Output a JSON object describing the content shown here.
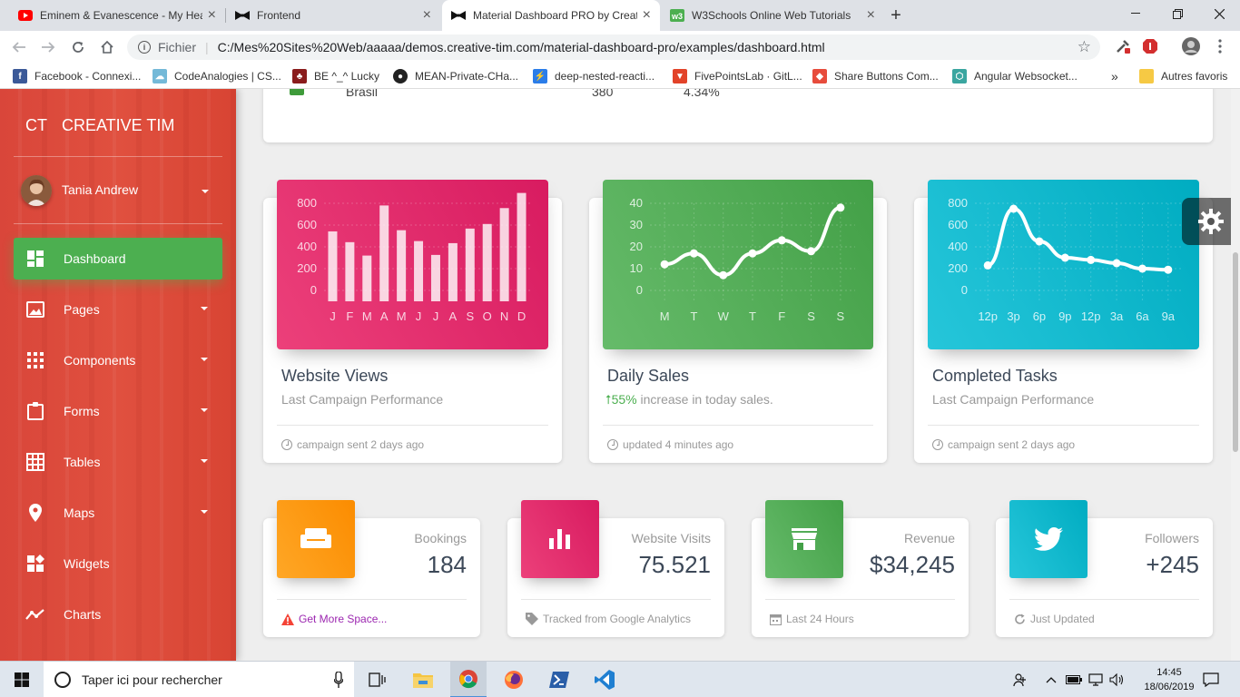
{
  "browser": {
    "tabs": [
      {
        "title": "Eminem & Evanescence - My Heart",
        "icon": "youtube-icon",
        "active": false
      },
      {
        "title": "Frontend",
        "icon": "bow-tie-icon",
        "active": false
      },
      {
        "title": "Material Dashboard PRO by Creative Tim",
        "icon": "bow-tie-icon",
        "active": true
      },
      {
        "title": "W3Schools Online Web Tutorials",
        "icon": "w3schools-icon",
        "active": false
      }
    ],
    "close_glyph": "×",
    "new_tab_glyph": "+",
    "address": {
      "scheme_label": "Fichier",
      "url": "C:/Mes%20Sites%20Web/aaaaa/demos.creative-tim.com/material-dashboard-pro/examples/dashboard.html"
    },
    "bookmarks": [
      {
        "label": "Facebook - Connexi...",
        "color": "#3b5998",
        "glyph": "f"
      },
      {
        "label": "CodeAnalogies | CS...",
        "color": "#74b9d8",
        "glyph": "☁"
      },
      {
        "label": "BE ^_^ Lucky",
        "color": "#8a1c1c",
        "glyph": "♣"
      },
      {
        "label": "MEAN-Private-CHa...",
        "color": "#222222",
        "glyph": "●"
      },
      {
        "label": "deep-nested-reacti...",
        "color": "#2b7de9",
        "glyph": "⚡"
      },
      {
        "label": "FivePointsLab · GitL...",
        "color": "#e24329",
        "glyph": "▼"
      },
      {
        "label": "Share Buttons Com...",
        "color": "#e74c3c",
        "glyph": "◆"
      },
      {
        "label": "Angular Websocket...",
        "color": "#3aa6a0",
        "glyph": "⬡"
      }
    ],
    "bookmarks_more": "»",
    "other_bookmarks": "Autres favoris"
  },
  "sidebar": {
    "logo_mini": "CT",
    "logo_text": "CREATIVE TIM",
    "user_name": "Tania Andrew",
    "items": [
      {
        "label": "Dashboard",
        "icon": "dashboard-icon",
        "active": true,
        "has_caret": false
      },
      {
        "label": "Pages",
        "icon": "image-icon",
        "active": false,
        "has_caret": true
      },
      {
        "label": "Components",
        "icon": "apps-grid-icon",
        "active": false,
        "has_caret": true
      },
      {
        "label": "Forms",
        "icon": "clipboard-icon",
        "active": false,
        "has_caret": true
      },
      {
        "label": "Tables",
        "icon": "grid-table-icon",
        "active": false,
        "has_caret": true
      },
      {
        "label": "Maps",
        "icon": "map-pin-icon",
        "active": false,
        "has_caret": true
      },
      {
        "label": "Widgets",
        "icon": "widgets-icon",
        "active": false,
        "has_caret": false
      },
      {
        "label": "Charts",
        "icon": "timeline-icon",
        "active": false,
        "has_caret": false
      }
    ]
  },
  "top_table_row": {
    "country": "Brasil",
    "value": "380",
    "percent": "4.34%"
  },
  "chart_cards": [
    {
      "title": "Website Views",
      "subtitle": "Last Campaign Performance",
      "footer": "campaign sent 2 days ago",
      "color": "#e91e63"
    },
    {
      "title": "Daily Sales",
      "subtitle_highlight": "55%",
      "subtitle": " increase in today sales.",
      "footer": "updated 4 minutes ago",
      "color": "#4caf50"
    },
    {
      "title": "Completed Tasks",
      "subtitle": "Last Campaign Performance",
      "footer": "campaign sent 2 days ago",
      "color": "#00bcd4"
    }
  ],
  "chart_data": [
    {
      "type": "bar",
      "categories": [
        "J",
        "F",
        "M",
        "A",
        "M",
        "J",
        "J",
        "A",
        "S",
        "O",
        "N",
        "D"
      ],
      "values": [
        542,
        443,
        320,
        780,
        553,
        453,
        326,
        434,
        568,
        610,
        756,
        895
      ],
      "yticks": [
        "0",
        "200",
        "400",
        "600",
        "800"
      ],
      "ylim": [
        0,
        1000
      ],
      "grid": true,
      "color": "#ffffff"
    },
    {
      "type": "line",
      "categories": [
        "M",
        "T",
        "W",
        "T",
        "F",
        "S",
        "S"
      ],
      "values": [
        12,
        17,
        7,
        17,
        23,
        18,
        38
      ],
      "yticks": [
        "0",
        "10",
        "20",
        "30",
        "40"
      ],
      "ylim": [
        0,
        50
      ],
      "grid": true,
      "color": "#ffffff"
    },
    {
      "type": "line",
      "categories": [
        "12p",
        "3p",
        "6p",
        "9p",
        "12p",
        "3a",
        "6a",
        "9a"
      ],
      "values": [
        230,
        750,
        450,
        300,
        280,
        250,
        200,
        190
      ],
      "yticks": [
        "0",
        "200",
        "400",
        "600",
        "800"
      ],
      "ylim": [
        0,
        1000
      ],
      "grid": true,
      "color": "#ffffff"
    }
  ],
  "stats": [
    {
      "label": "Bookings",
      "value": "184",
      "footer": "Get More Space...",
      "footer_icon": "warning-icon",
      "icon": "weekend-icon",
      "color": "#ff9800",
      "footer_link": true
    },
    {
      "label": "Website Visits",
      "value": "75.521",
      "footer": "Tracked from Google Analytics",
      "footer_icon": "tag-icon",
      "icon": "bar-chart-icon",
      "color": "#e91e63",
      "footer_link": false
    },
    {
      "label": "Revenue",
      "value": "$34,245",
      "footer": "Last 24 Hours",
      "footer_icon": "calendar-icon",
      "icon": "store-icon",
      "color": "#4caf50",
      "footer_link": false
    },
    {
      "label": "Followers",
      "value": "+245",
      "footer": "Just Updated",
      "footer_icon": "update-icon",
      "icon": "twitter-icon",
      "color": "#00bcd4",
      "footer_link": false
    }
  ],
  "taskbar": {
    "search_placeholder": "Taper ici pour rechercher",
    "time": "14:45",
    "date": "18/06/2019"
  }
}
